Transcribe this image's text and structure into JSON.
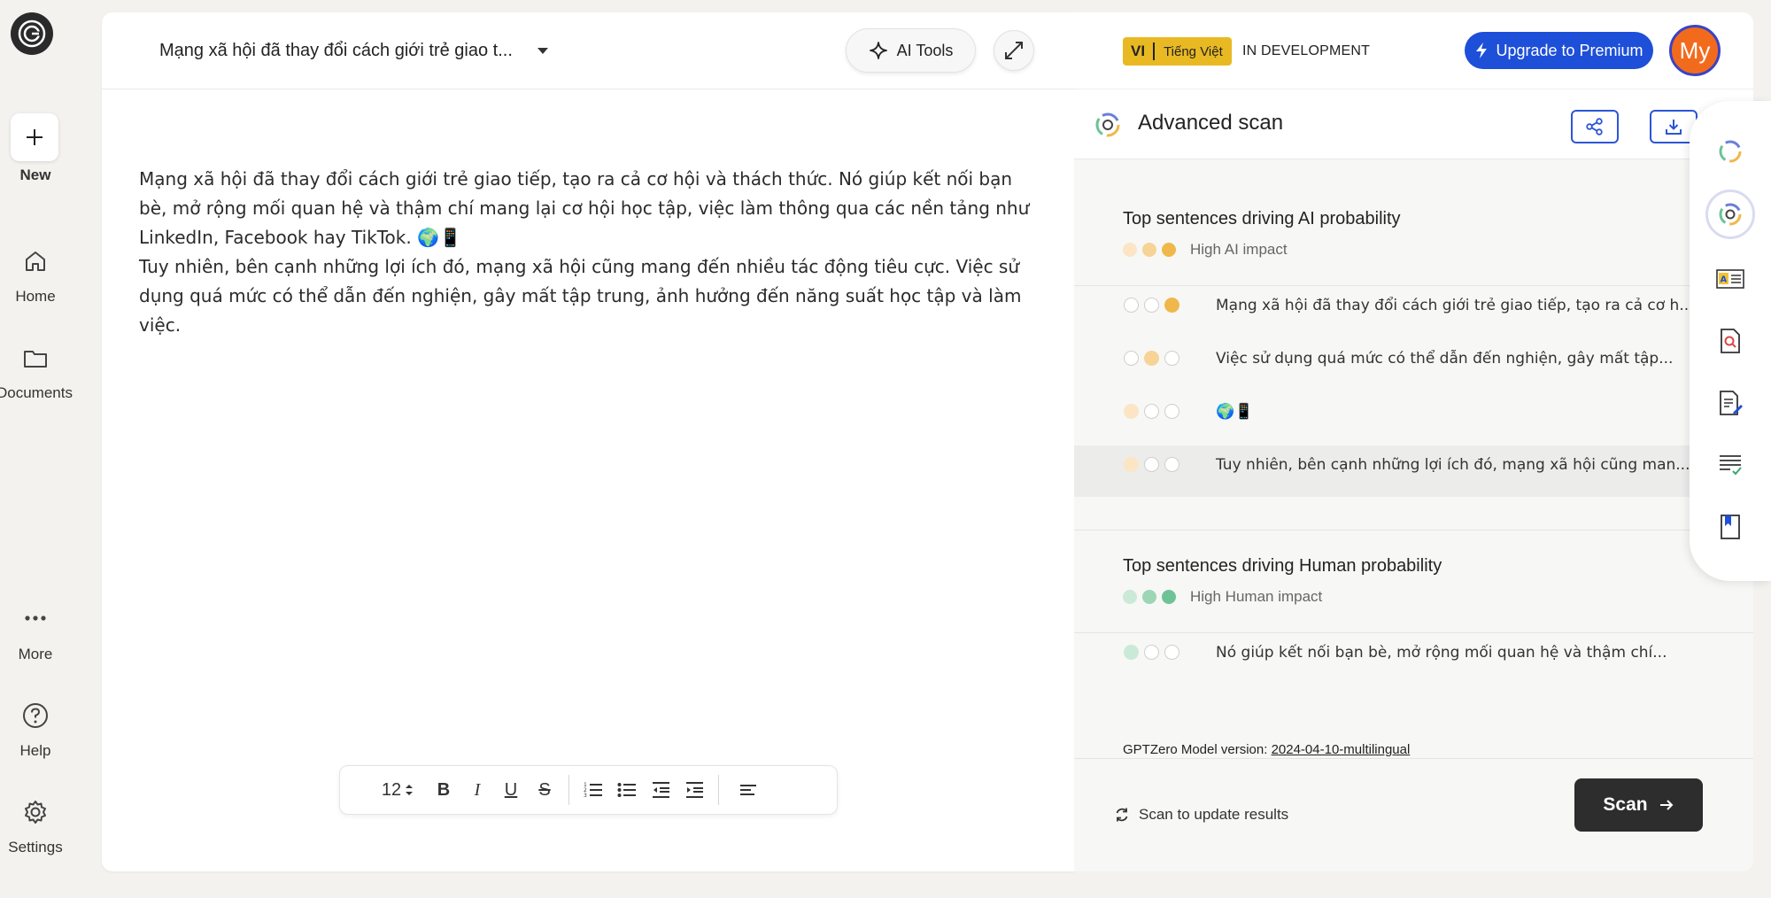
{
  "rail": {
    "new_label": "New",
    "home_label": "Home",
    "documents_label": "Documents",
    "more_label": "More",
    "help_label": "Help",
    "settings_label": "Settings"
  },
  "editor": {
    "doc_title": "Mạng xã hội đã thay đổi cách giới trẻ giao t...",
    "ai_tools_label": "AI Tools",
    "paragraphs": [
      "Mạng xã hội đã thay đổi cách giới trẻ giao tiếp, tạo ra cả cơ hội và thách thức. Nó giúp kết nối bạn bè, mở rộng mối quan hệ và thậm chí mang lại cơ hội học tập, việc làm thông qua các nền tảng như LinkedIn, Facebook hay TikTok. 🌍📱",
      "Tuy nhiên, bên cạnh những lợi ích đó, mạng xã hội cũng mang đến nhiều tác động tiêu cực. Việc sử dụng quá mức có thể dẫn đến nghiện, gây mất tập trung, ảnh hưởng đến năng suất học tập và làm việc."
    ],
    "font_size": "12"
  },
  "header": {
    "lang_code": "VI",
    "lang_name": "Tiếng Việt",
    "status": "IN DEVELOPMENT",
    "upgrade_label": "Upgrade to Premium",
    "avatar_initials": "My"
  },
  "scan": {
    "title": "Advanced scan",
    "ai_section": {
      "title": "Top sentences driving AI probability",
      "impact": "High AI impact",
      "rows": [
        {
          "text": "Mạng xã hội đã thay đổi cách giới trẻ giao tiếp, tạo ra cả cơ h...",
          "level": 3
        },
        {
          "text": "Việc sử dụng quá mức có thể dẫn đến nghiện, gây mất tập...",
          "level": 2
        },
        {
          "text": "🌍📱",
          "level": 1
        },
        {
          "text": "Tuy nhiên, bên cạnh những lợi ích đó, mạng xã hội cũng man...",
          "level": 1
        }
      ]
    },
    "human_section": {
      "title": "Top sentences driving Human probability",
      "impact": "High Human impact",
      "rows": [
        {
          "text": "Nó giúp kết nối bạn bè, mở rộng mối quan hệ và thậm chí...",
          "level": 1
        }
      ]
    },
    "model_label": "GPTZero Model version:",
    "model_version": "2024-04-10-multilingual",
    "update_label": "Scan to update results",
    "scan_label": "Scan"
  },
  "colors": {
    "ai_impact": "#f0b84a",
    "human_impact": "#6dc395",
    "accent_blue": "#1d4fd8"
  }
}
